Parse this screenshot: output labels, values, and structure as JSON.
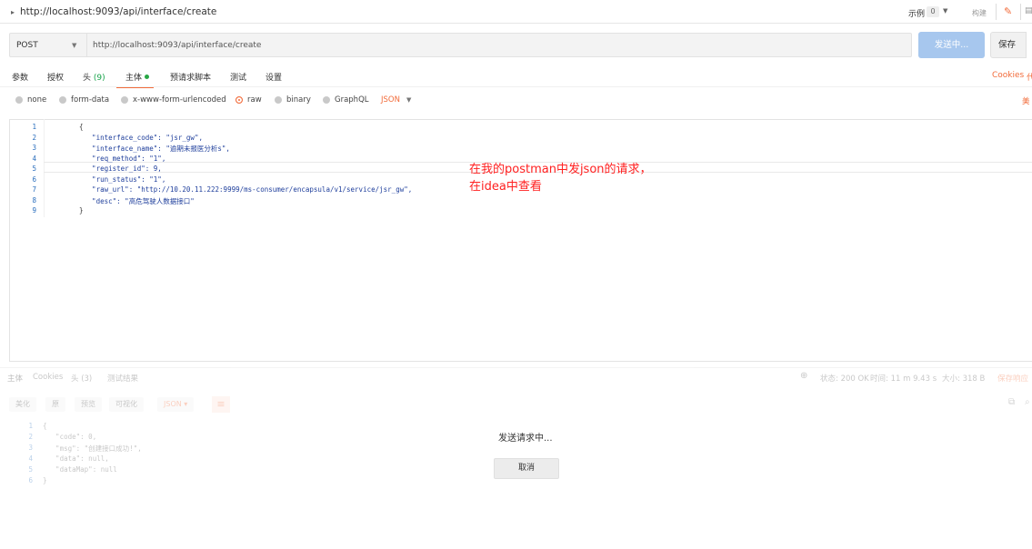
{
  "titlebar": {
    "title": "http://localhost:9093/api/interface/create",
    "examples_label": "示例",
    "examples_count": "0",
    "build_label": "构建"
  },
  "request": {
    "method": "POST",
    "url": "http://localhost:9093/api/interface/create",
    "send_label": "发送中...",
    "save_label": "保存"
  },
  "tabs": [
    {
      "label": "参数"
    },
    {
      "label": "授权"
    },
    {
      "label": "头",
      "count": "(9)"
    },
    {
      "label": "主体"
    },
    {
      "label": "预请求脚本"
    },
    {
      "label": "测试"
    },
    {
      "label": "设置"
    }
  ],
  "cookies_label": "Cookies",
  "body_types": [
    "none",
    "form-data",
    "x-www-form-urlencoded",
    "raw",
    "binary",
    "GraphQL"
  ],
  "selected_body_type": "raw",
  "format_label": "JSON",
  "editor": {
    "line_numbers": [
      "1",
      "2",
      "3",
      "4",
      "5",
      "6",
      "7",
      "8",
      "9"
    ],
    "lines": [
      "{",
      "    \"interface_code\": \"jsr_gw\",",
      "    \"interface_name\": \"逾期未报医分析s\",",
      "    \"req_method\": \"1\",",
      "    \"register_id\": 9,",
      "    \"run_status\": \"1\",",
      "    \"raw_url\": \"http://10.20.11.222:9999/ms-consumer/encapsula/v1/service/jsr_gw\",",
      "    \"desc\": \"高危驾驶人数据接口\"",
      "}"
    ]
  },
  "annotation": {
    "line1": "在我的postman中发json的请求，",
    "line2": "在idea中查看"
  },
  "response": {
    "tabs": [
      "主体",
      "Cookies",
      "头 (3)",
      "测试结果"
    ],
    "view_buttons": [
      "美化",
      "原",
      "预览",
      "可视化",
      "JSON"
    ],
    "status": "状态: 200 OK",
    "time": "时间: 11 m 9.43 s",
    "size": "大小: 318 B",
    "save_response": "保存响应",
    "line_numbers": [
      "1",
      "2",
      "3",
      "4",
      "5",
      "6"
    ],
    "lines": [
      "{",
      "    \"code\": 0,",
      "    \"msg\": \"创建接口成功!\",",
      "    \"data\": null,",
      "    \"dataMap\": null",
      "}"
    ]
  },
  "overlay": {
    "sending_text": "发送请求中...",
    "cancel_label": "取消"
  },
  "colors": {
    "accent": "#f26b3a",
    "send_button": "#a7c7ee",
    "annotation": "#ff2020"
  }
}
